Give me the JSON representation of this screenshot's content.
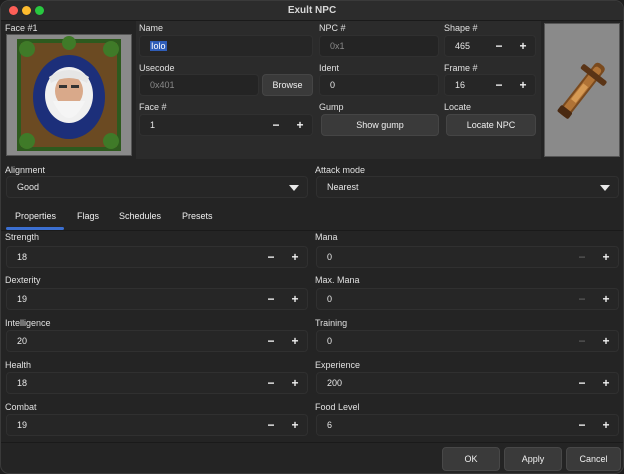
{
  "window": {
    "title": "Exult NPC"
  },
  "face_panel": {
    "label": "Face #1",
    "portrait_icon": "bearded-elder-portrait"
  },
  "name": {
    "label": "Name",
    "value": "Iolo"
  },
  "npc_num": {
    "label": "NPC #",
    "placeholder": "0x1"
  },
  "shape": {
    "label": "Shape #",
    "value": "465"
  },
  "usecode": {
    "label": "Usecode",
    "placeholder": "0x401",
    "browse_label": "Browse"
  },
  "ident": {
    "label": "Ident",
    "value": "0"
  },
  "frame": {
    "label": "Frame #",
    "value": "16"
  },
  "face_num": {
    "label": "Face #",
    "value": "1"
  },
  "gump": {
    "label": "Gump",
    "button_label": "Show gump"
  },
  "locate": {
    "label": "Locate",
    "button_label": "Locate NPC"
  },
  "shape_preview": {
    "icon": "crossbow-sprite"
  },
  "alignment": {
    "label": "Alignment",
    "value": "Good"
  },
  "attack_mode": {
    "label": "Attack mode",
    "value": "Nearest"
  },
  "tabs": [
    {
      "label": "Properties",
      "active": true
    },
    {
      "label": "Flags"
    },
    {
      "label": "Schedules"
    },
    {
      "label": "Presets"
    }
  ],
  "stats_left": [
    {
      "label": "Strength",
      "value": "18"
    },
    {
      "label": "Dexterity",
      "value": "19"
    },
    {
      "label": "Intelligence",
      "value": "20"
    },
    {
      "label": "Health",
      "value": "18"
    },
    {
      "label": "Combat",
      "value": "19"
    }
  ],
  "stats_right": [
    {
      "label": "Mana",
      "value": "0"
    },
    {
      "label": "Max. Mana",
      "value": "0"
    },
    {
      "label": "Training",
      "value": "0"
    },
    {
      "label": "Experience",
      "value": "200"
    },
    {
      "label": "Food Level",
      "value": "6"
    }
  ],
  "stepper": {
    "minus": "−",
    "plus": "+"
  },
  "footer": {
    "ok_label": "OK",
    "apply_label": "Apply",
    "cancel_label": "Cancel"
  },
  "colors": {
    "accent": "#3b6fd1",
    "selection": "#2f5db8",
    "background": "#242424"
  }
}
